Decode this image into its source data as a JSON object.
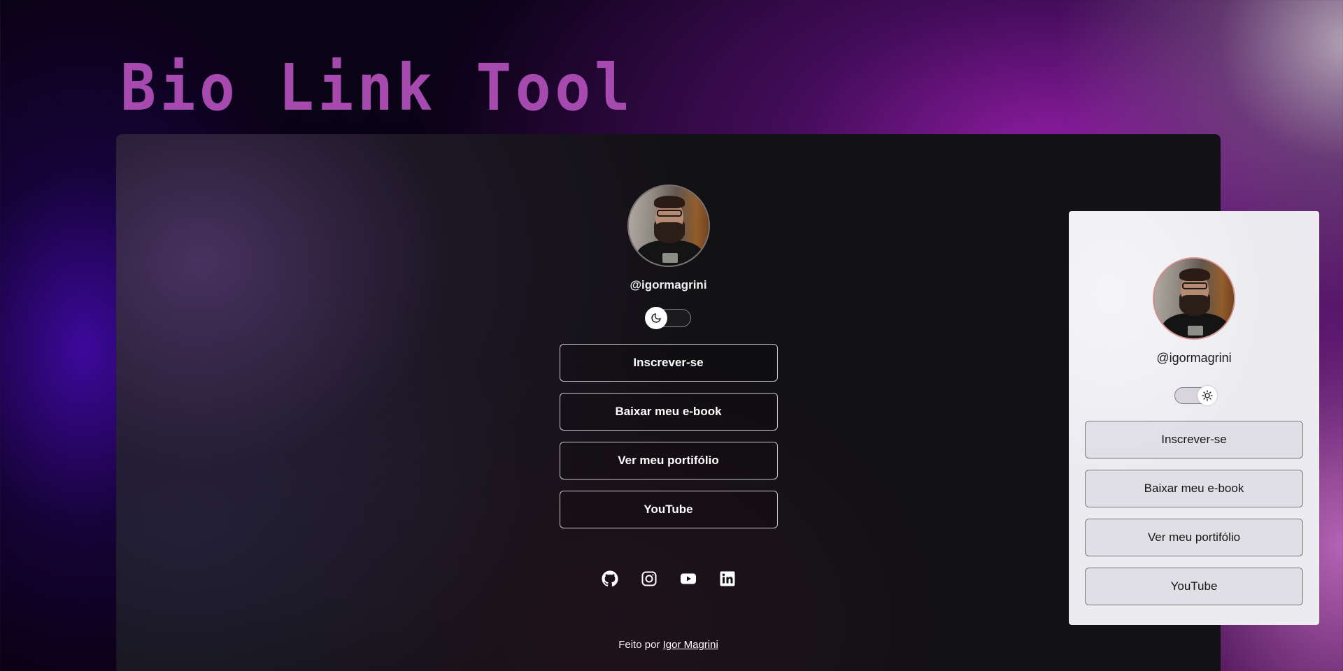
{
  "app": {
    "title": "Bio Link Tool"
  },
  "profile": {
    "handle": "@igormagrini"
  },
  "theme_toggle": {
    "dark_icon": "moon-icon",
    "light_icon": "sun-icon"
  },
  "links": [
    {
      "label": "Inscrever-se"
    },
    {
      "label": "Baixar meu e-book"
    },
    {
      "label": "Ver meu portifólio"
    },
    {
      "label": "YouTube"
    }
  ],
  "social": [
    {
      "icon": "github-icon"
    },
    {
      "icon": "instagram-icon"
    },
    {
      "icon": "youtube-icon"
    },
    {
      "icon": "linkedin-icon"
    }
  ],
  "footer": {
    "prefix": "Feito por ",
    "author_link": "Igor Magrini"
  },
  "colors": {
    "title": "#a64ab0",
    "dark_panel_bg": "#121114",
    "light_panel_bg": "#ecebf0",
    "avatar_border_light": "#d4938f"
  }
}
